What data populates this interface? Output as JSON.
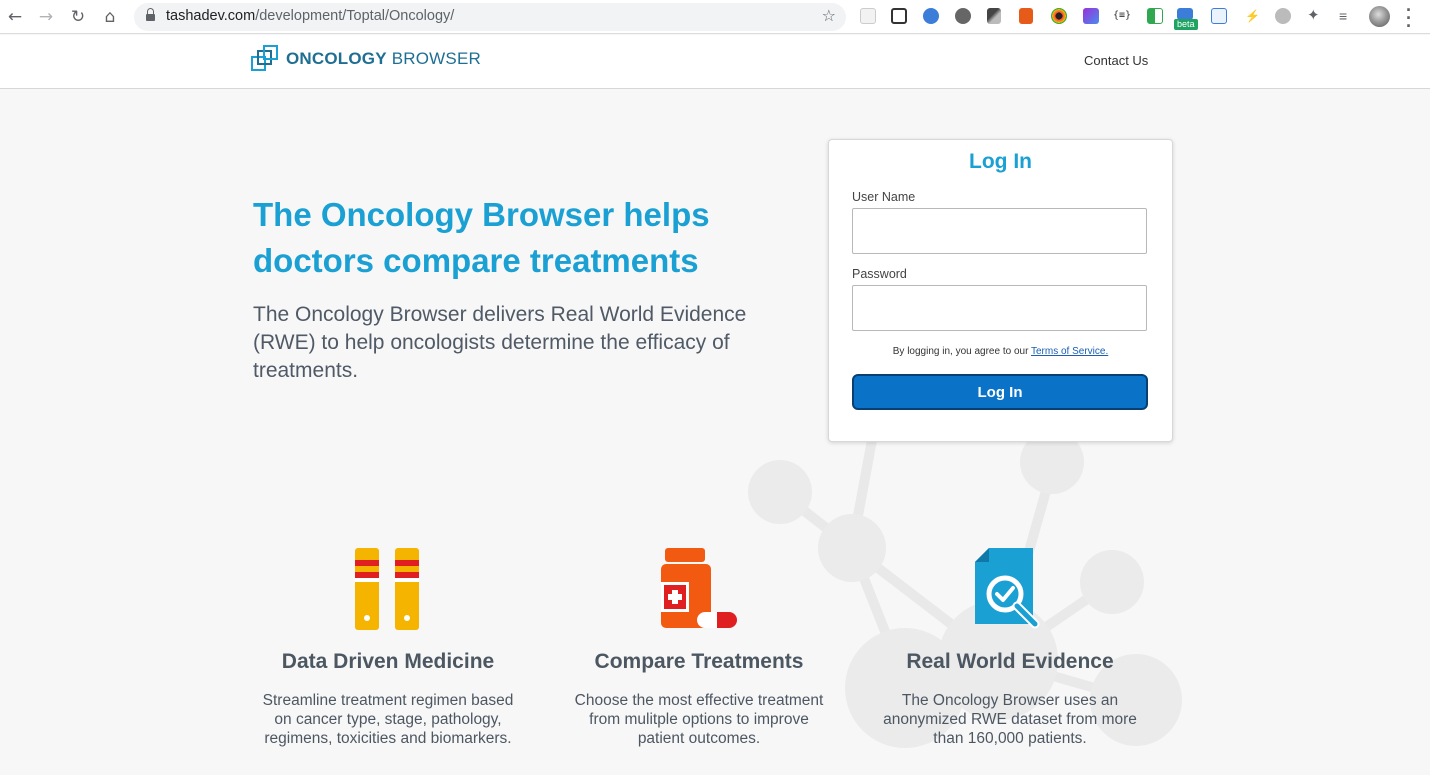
{
  "browser": {
    "url_host": "tashadev.com",
    "url_path": "/development/Toptal/Oncology/",
    "beta_badge": "beta"
  },
  "header": {
    "logo_bold": "ONCOLOGY",
    "logo_light": "BROWSER",
    "contact_label": "Contact Us"
  },
  "hero": {
    "title": "The Oncology Browser helps doctors compare treatments",
    "subtitle": "The Oncology Browser delivers Real World Evidence (RWE) to help oncologists determine the efficacy of treatments."
  },
  "login": {
    "title": "Log In",
    "username_label": "User Name",
    "username_value": "",
    "password_label": "Password",
    "password_value": "",
    "terms_prefix": "By logging in, you agree to our ",
    "terms_link": "Terms of Service.",
    "button_label": "Log In"
  },
  "features": [
    {
      "icon": "test-tubes-icon",
      "title": "Data Driven Medicine",
      "description": "Streamline treatment regimen based on cancer type, stage, pathology, regimens, toxicities and biomarkers."
    },
    {
      "icon": "medicine-bottle-icon",
      "title": "Compare Treatments",
      "description": "Choose the most effective treatment from mulitple options to improve patient outcomes."
    },
    {
      "icon": "document-search-icon",
      "title": "Real World Evidence",
      "description": "The Oncology Browser uses an anonymized RWE dataset from more than 160,000 patients."
    }
  ],
  "colors": {
    "accent": "#1aa0d3",
    "button": "#0a73c8",
    "logo": "#1f6f93",
    "tube_yellow": "#f5b400",
    "tube_red": "#e02020",
    "bottle_orange": "#f25a12"
  }
}
